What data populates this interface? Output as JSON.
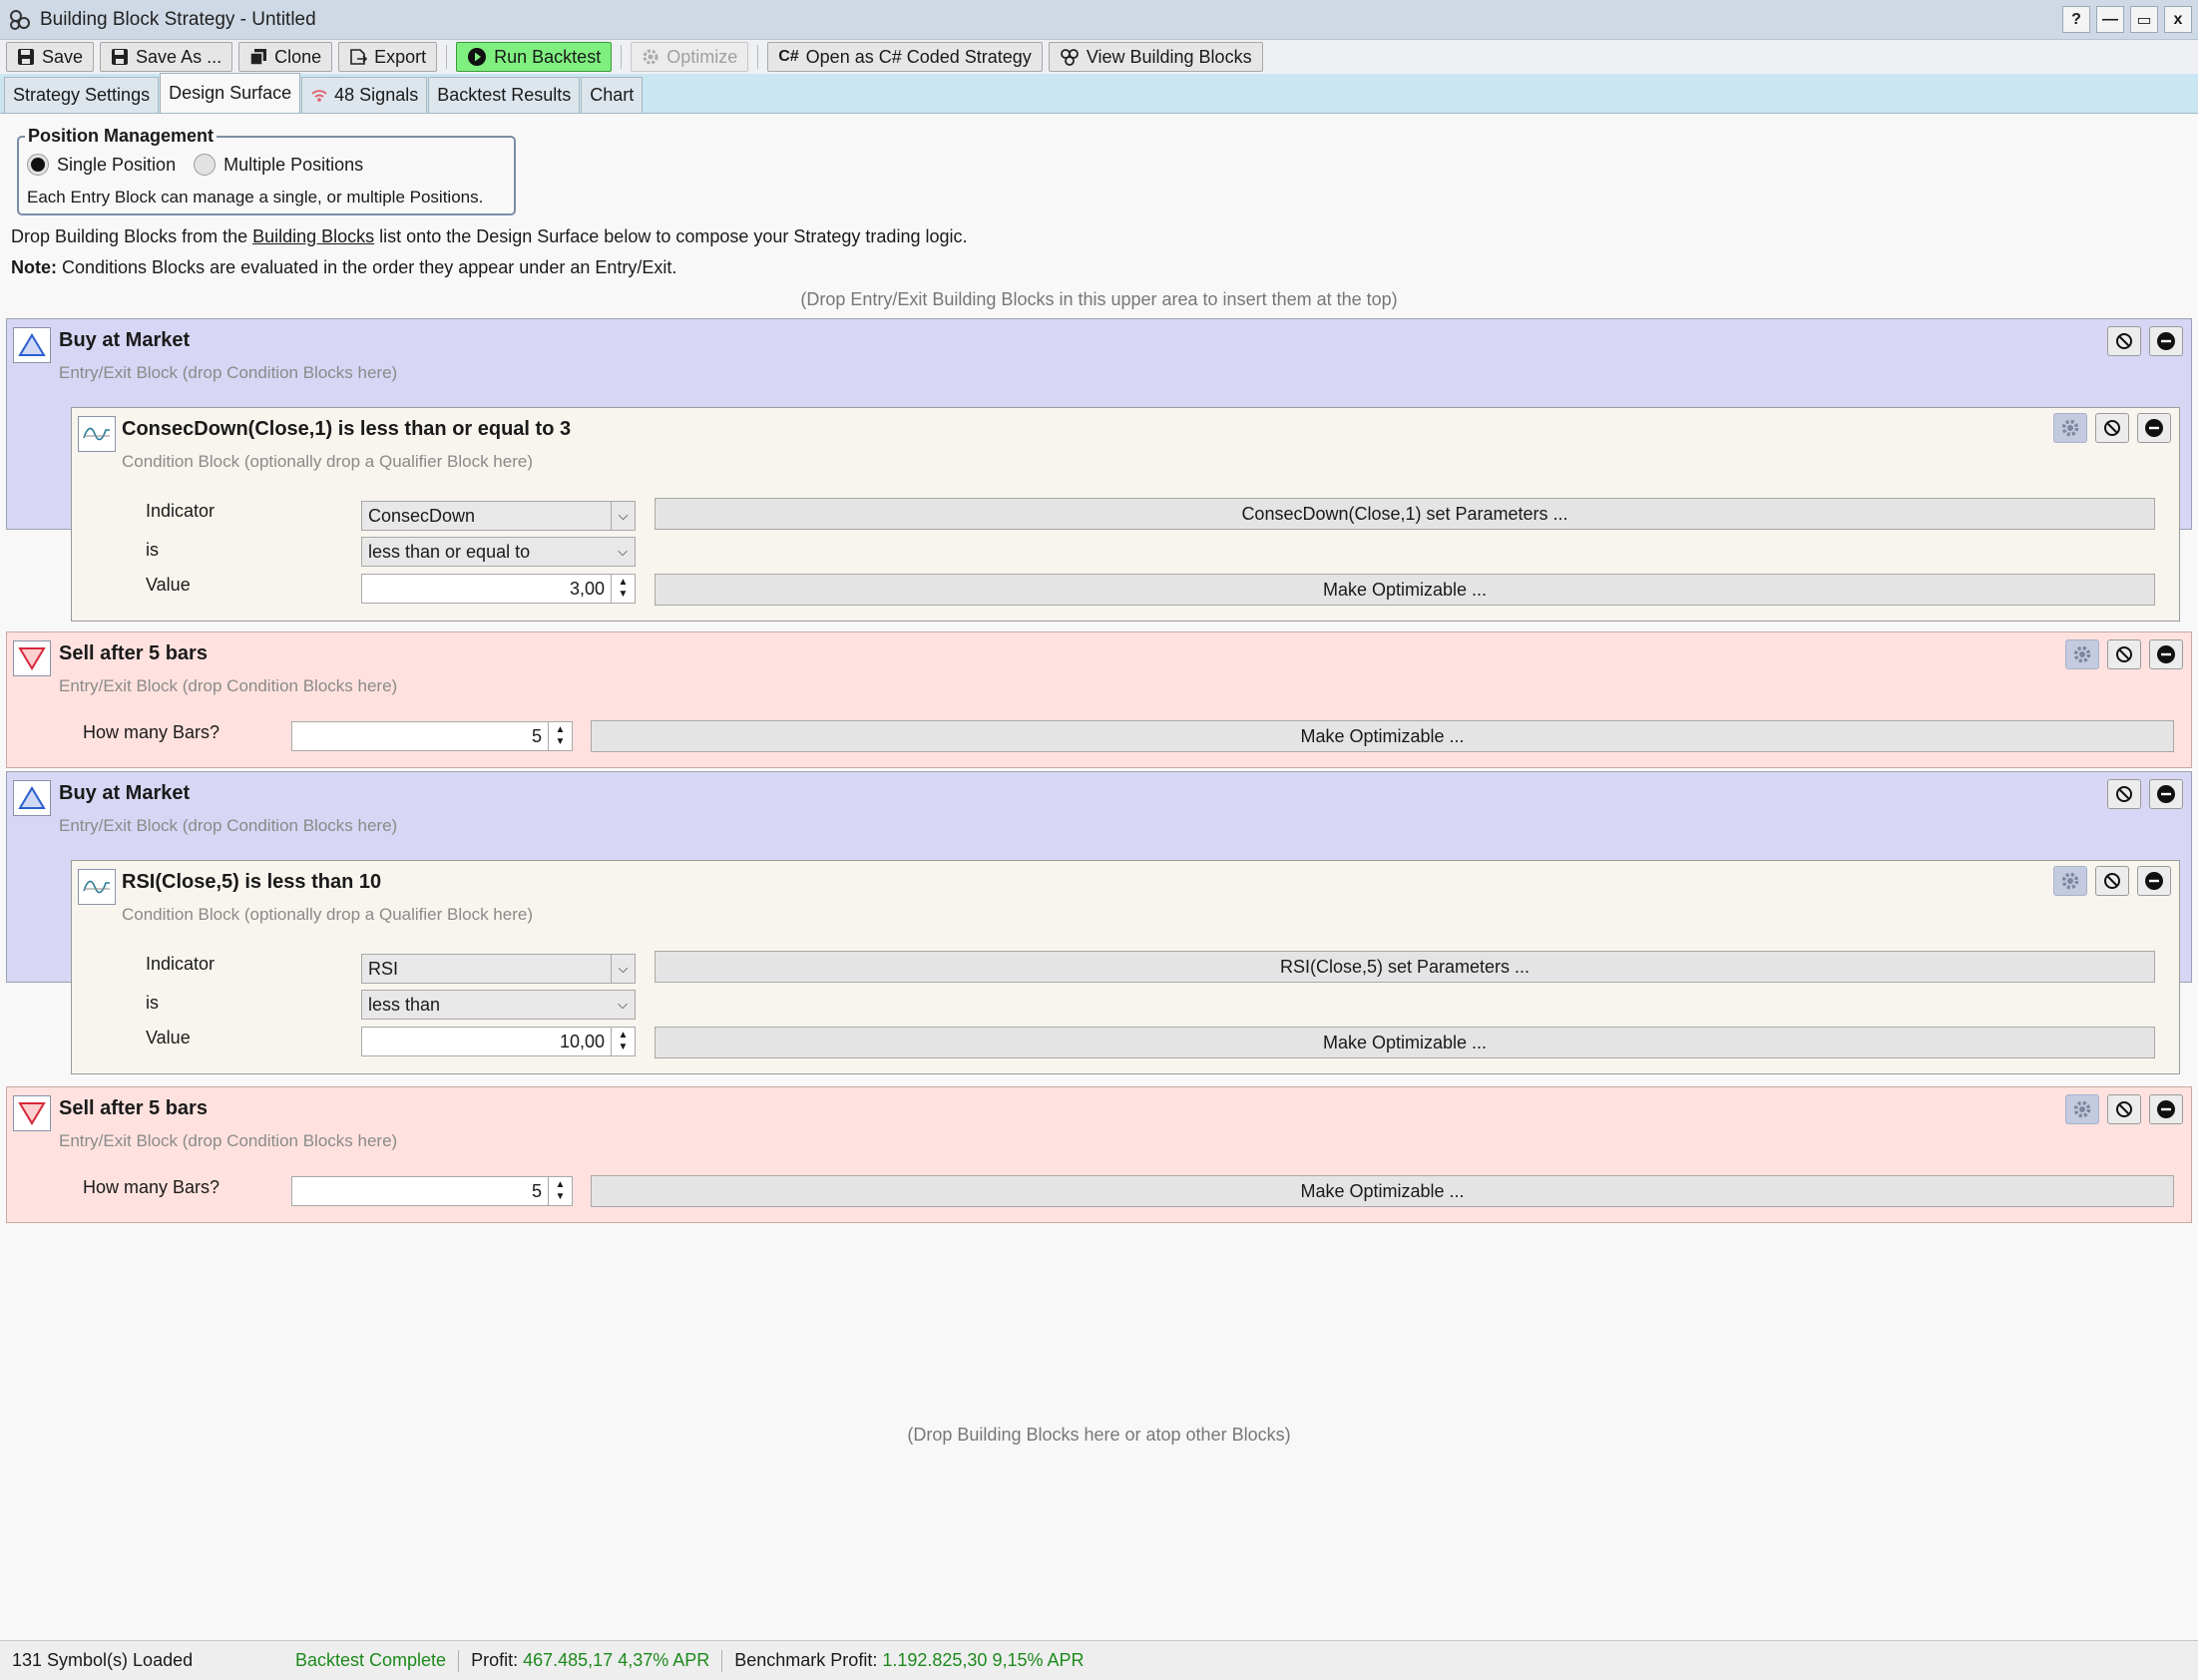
{
  "window": {
    "title": "Building Block Strategy - Untitled",
    "buttons": [
      "?",
      "—",
      "▭",
      "x"
    ]
  },
  "toolbar": {
    "save": "Save",
    "save_as": "Save As ...",
    "clone": "Clone",
    "export": "Export",
    "run_backtest": "Run Backtest",
    "optimize": "Optimize",
    "open_csharp": "Open as C# Coded Strategy",
    "view_blocks": "View Building Blocks"
  },
  "tabs": {
    "strategy_settings": "Strategy Settings",
    "design_surface": "Design Surface",
    "signals": "48 Signals",
    "backtest_results": "Backtest Results",
    "chart": "Chart"
  },
  "position_management": {
    "legend": "Position Management",
    "single": "Single Position",
    "multiple": "Multiple Positions",
    "description": "Each Entry Block can manage a single, or multiple Positions."
  },
  "intro": {
    "line1_pre": "Drop Building Blocks from the ",
    "line1_link": "Building Blocks",
    "line1_post": " list onto the Design Surface below to compose your Strategy trading logic.",
    "note_label": "Note:",
    "note_text": " Conditions Blocks are evaluated in the order they appear under an Entry/Exit."
  },
  "hints": {
    "top": "(Drop Entry/Exit Building Blocks in this upper area to insert them at the top)",
    "bottom": "(Drop Building Blocks here or atop other Blocks)"
  },
  "blocks": [
    {
      "type": "buy",
      "title": "Buy at Market",
      "subtitle": "Entry/Exit Block (drop Condition Blocks here)",
      "condition": {
        "title": "ConsecDown(Close,1) is less than or equal to 3",
        "subtitle": "Condition Block (optionally drop a Qualifier Block here)",
        "indicator_label": "Indicator",
        "indicator_value": "ConsecDown",
        "is_label": "is",
        "is_value": "less than or equal to",
        "value_label": "Value",
        "value": "3,00",
        "params_button": "ConsecDown(Close,1) set Parameters ...",
        "optimizable_button": "Make Optimizable ..."
      }
    },
    {
      "type": "sell",
      "title": "Sell after 5 bars",
      "subtitle": "Entry/Exit Block (drop Condition Blocks here)",
      "bars_label": "How many Bars?",
      "bars_value": "5",
      "optimizable_button": "Make Optimizable ..."
    },
    {
      "type": "buy",
      "title": "Buy at Market",
      "subtitle": "Entry/Exit Block (drop Condition Blocks here)",
      "condition": {
        "title": "RSI(Close,5) is less than 10",
        "subtitle": "Condition Block (optionally drop a Qualifier Block here)",
        "indicator_label": "Indicator",
        "indicator_value": "RSI",
        "is_label": "is",
        "is_value": "less than",
        "value_label": "Value",
        "value": "10,00",
        "params_button": "RSI(Close,5) set Parameters ...",
        "optimizable_button": "Make Optimizable ..."
      }
    },
    {
      "type": "sell",
      "title": "Sell after 5 bars",
      "subtitle": "Entry/Exit Block (drop Condition Blocks here)",
      "bars_label": "How many Bars?",
      "bars_value": "5",
      "optimizable_button": "Make Optimizable ..."
    }
  ],
  "status": {
    "symbols": "131 Symbol(s) Loaded",
    "backtest": "Backtest Complete",
    "profit_label": "Profit:",
    "profit_value": "467.485,17 4,37% APR",
    "benchmark_label": "Benchmark Profit:",
    "benchmark_value": "1.192.825,30 9,15% APR"
  },
  "colors": {
    "buy_block": "#d7d6f4",
    "sell_block": "#ffe2df",
    "run_button": "#7ff07f",
    "status_green": "#1d8a1d"
  }
}
